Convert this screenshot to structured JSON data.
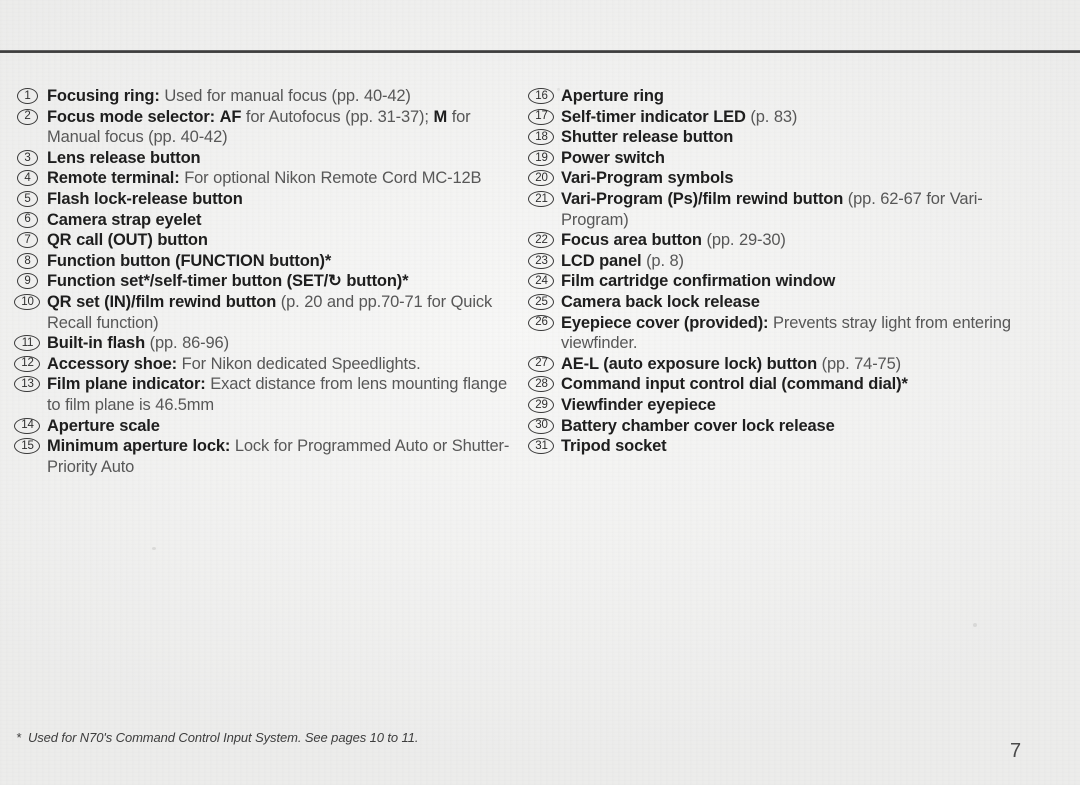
{
  "page": {
    "page_number": "7",
    "footnote_marker": "*",
    "footnote": "Used for N70's Command Control Input System. See pages 10 to 11."
  },
  "left_column": [
    {
      "number": "1",
      "bold": "Focusing ring:",
      "rest": " Used for manual focus (pp. 40-42)"
    },
    {
      "number": "2",
      "bold": "Focus mode selector:",
      "rest": " AF for Autofocus (pp. 31-37); M for Manual focus (pp. 40-42)",
      "inline_bold": [
        "AF",
        "M"
      ]
    },
    {
      "number": "3",
      "bold": "Lens release button",
      "rest": ""
    },
    {
      "number": "4",
      "bold": "Remote terminal:",
      "rest": " For optional Nikon Remote Cord MC-12B"
    },
    {
      "number": "5",
      "bold": "Flash lock-release button",
      "rest": ""
    },
    {
      "number": "6",
      "bold": "Camera strap eyelet",
      "rest": ""
    },
    {
      "number": "7",
      "bold": "QR call (OUT) button",
      "rest": ""
    },
    {
      "number": "8",
      "bold": "Function button (FUNCTION button)*",
      "rest": ""
    },
    {
      "number": "9",
      "bold": "Function set*/self-timer button (SET/↻ button)*",
      "rest": ""
    },
    {
      "number": "10",
      "bold": "QR set (IN)/film rewind button",
      "rest": " (p. 20 and pp.70-71 for Quick Recall function)"
    },
    {
      "number": "11",
      "bold": "Built-in flash",
      "rest": " (pp. 86-96)"
    },
    {
      "number": "12",
      "bold": "Accessory shoe:",
      "rest": " For Nikon dedicated Speedlights."
    },
    {
      "number": "13",
      "bold": "Film plane indicator:",
      "rest": " Exact distance from lens mounting flange to film plane is 46.5mm"
    },
    {
      "number": "14",
      "bold": "Aperture scale",
      "rest": ""
    },
    {
      "number": "15",
      "bold": "Minimum aperture lock:",
      "rest": " Lock for Programmed Auto or Shutter-Priority Auto"
    }
  ],
  "right_column": [
    {
      "number": "16",
      "bold": "Aperture ring",
      "rest": ""
    },
    {
      "number": "17",
      "bold": "Self-timer indicator LED",
      "rest": " (p. 83)"
    },
    {
      "number": "18",
      "bold": "Shutter release button",
      "rest": ""
    },
    {
      "number": "19",
      "bold": "Power switch",
      "rest": ""
    },
    {
      "number": "20",
      "bold": "Vari-Program symbols",
      "rest": ""
    },
    {
      "number": "21",
      "bold": "Vari-Program (Ps)/film rewind button",
      "rest": " (pp. 62-67 for Vari-Program)"
    },
    {
      "number": "22",
      "bold": "Focus area button",
      "rest": " (pp. 29-30)"
    },
    {
      "number": "23",
      "bold": "LCD panel",
      "rest": " (p. 8)"
    },
    {
      "number": "24",
      "bold": "Film cartridge confirmation window",
      "rest": ""
    },
    {
      "number": "25",
      "bold": "Camera back lock release",
      "rest": ""
    },
    {
      "number": "26",
      "bold": "Eyepiece cover (provided):",
      "rest": " Prevents stray light from entering viewfinder."
    },
    {
      "number": "27",
      "bold": "AE-L (auto exposure lock) button",
      "rest": " (pp. 74-75)"
    },
    {
      "number": "28",
      "bold": "Command input control dial (command dial)*",
      "rest": ""
    },
    {
      "number": "29",
      "bold": "Viewfinder eyepiece",
      "rest": ""
    },
    {
      "number": "30",
      "bold": "Battery chamber cover lock release",
      "rest": ""
    },
    {
      "number": "31",
      "bold": "Tripod socket",
      "rest": ""
    }
  ]
}
